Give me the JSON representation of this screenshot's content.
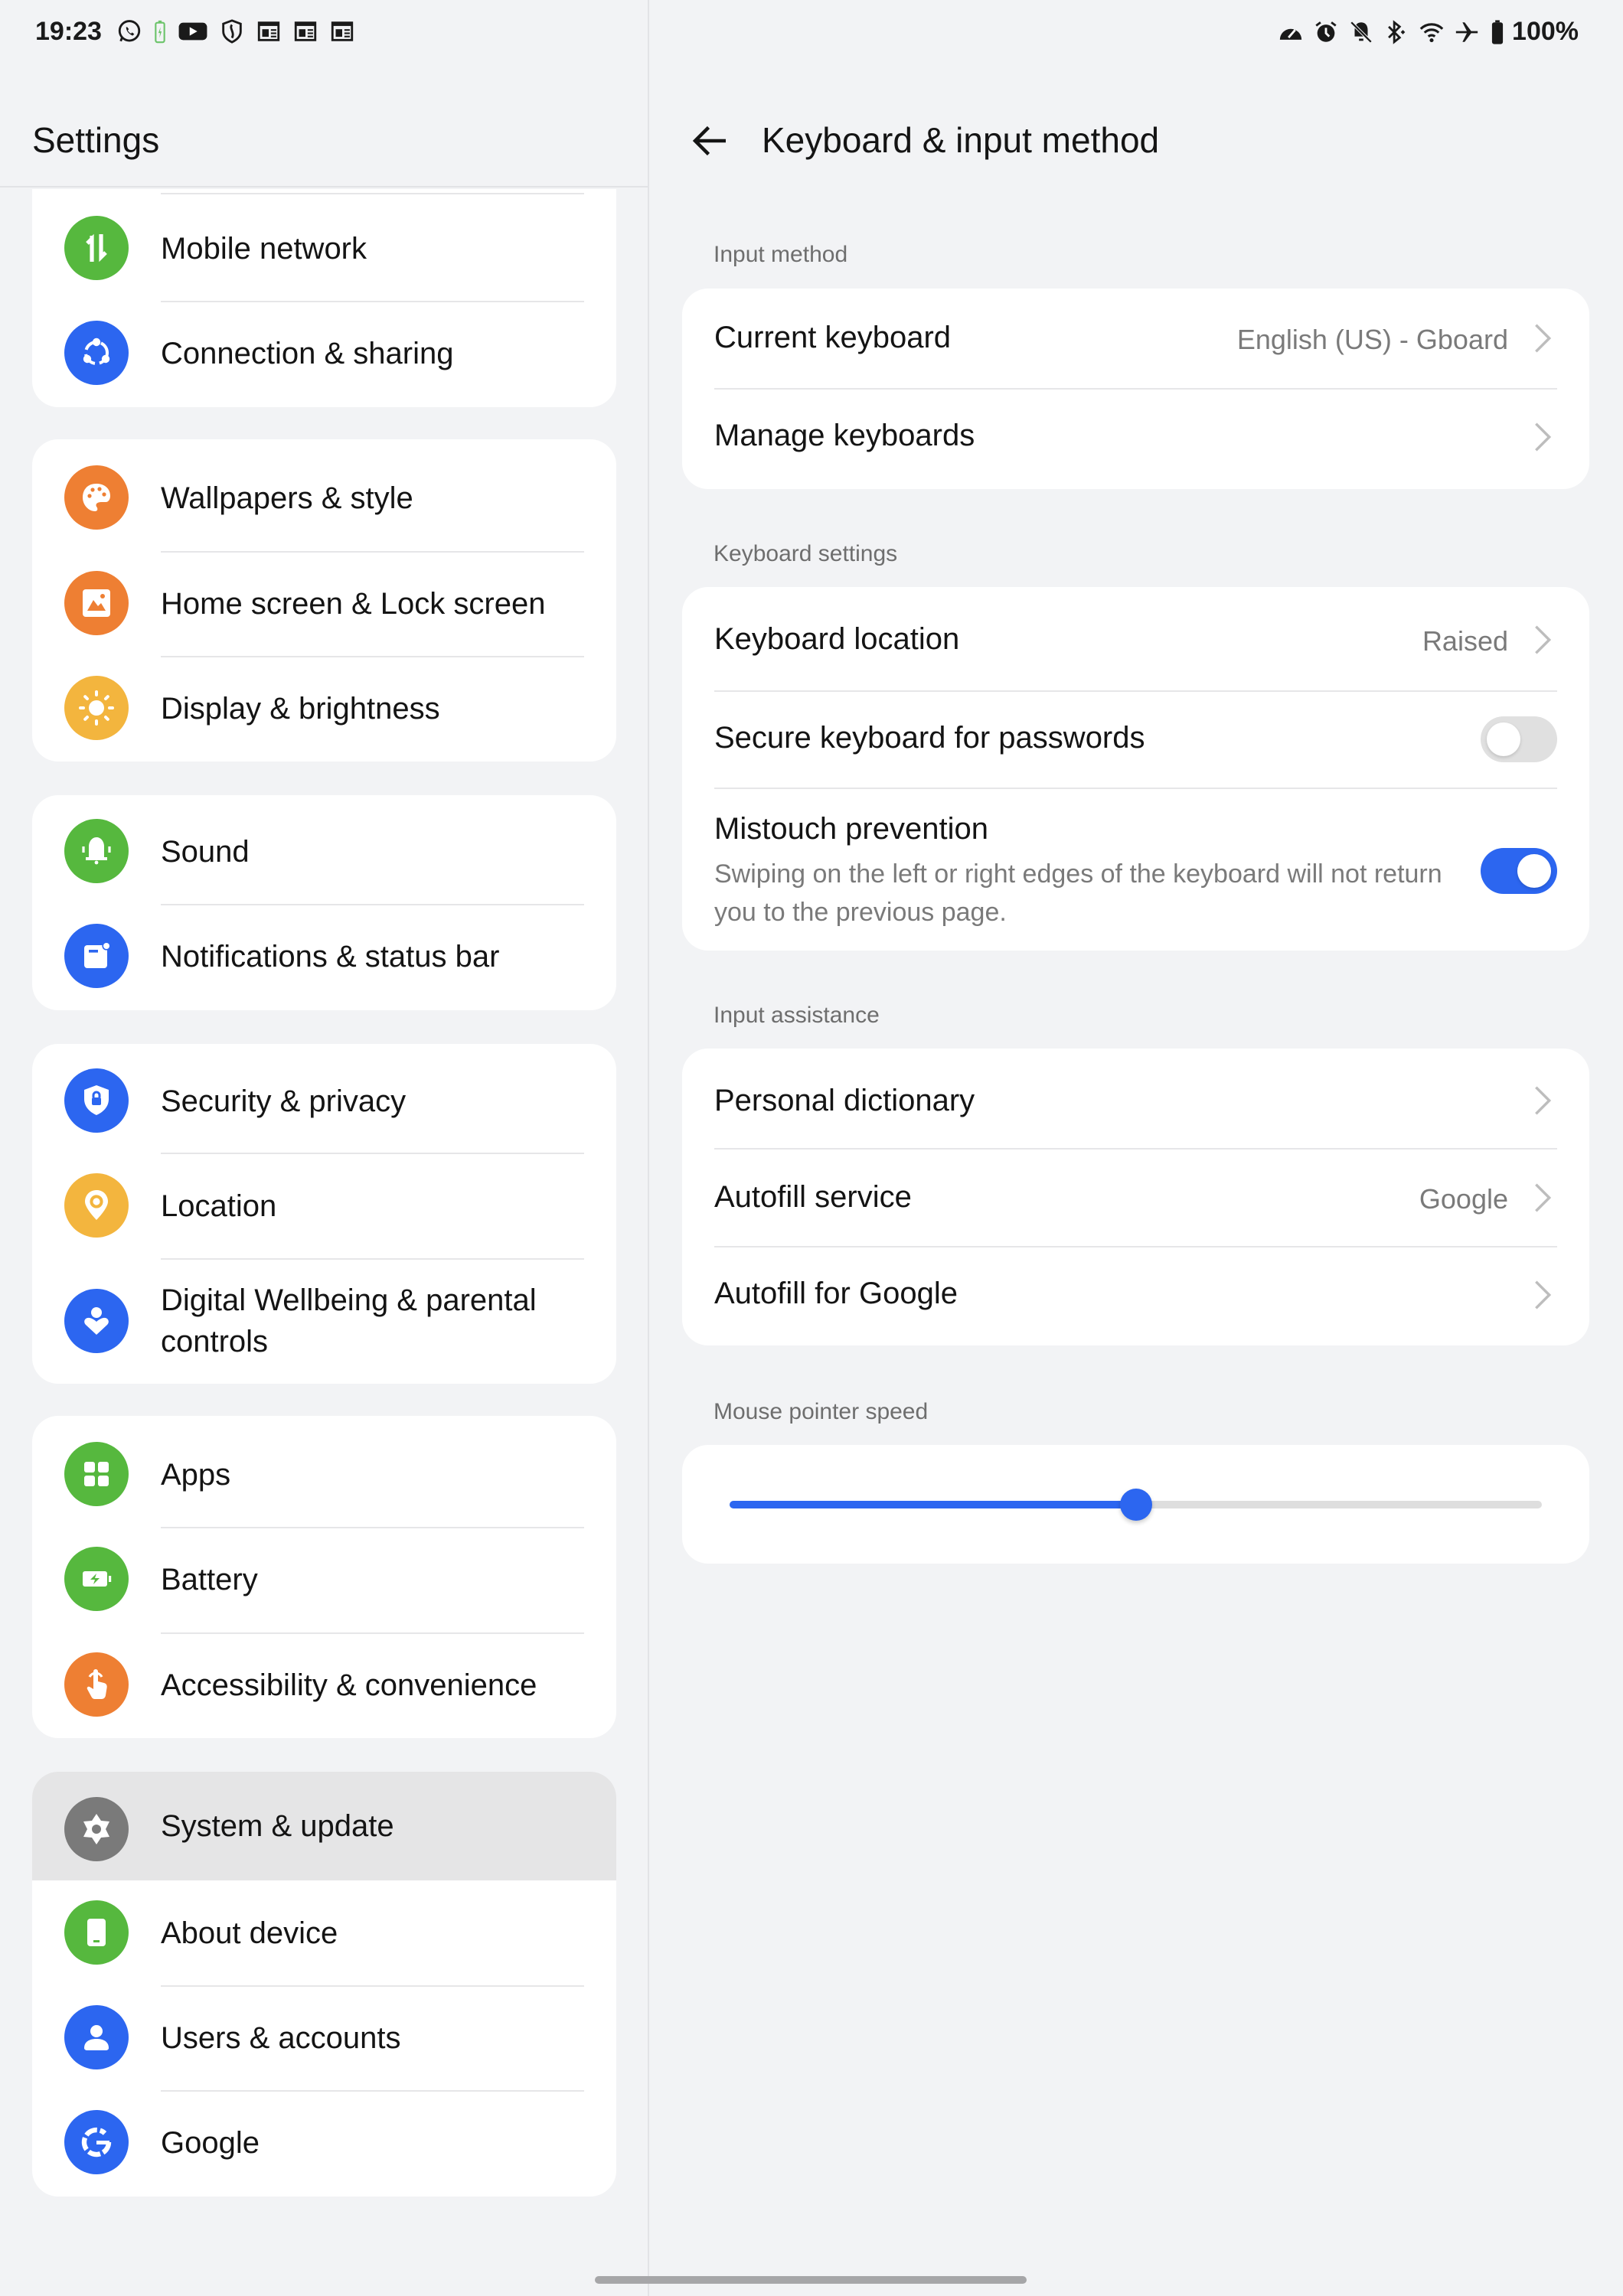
{
  "status_bar": {
    "time": "19:23",
    "left_icons": [
      "whatsapp-icon",
      "battery-saver-icon",
      "youtube-icon",
      "shield-icon",
      "news-icon",
      "news-icon",
      "news-icon"
    ],
    "right_icons": [
      "data-saver-icon",
      "alarm-icon",
      "bell-off-icon",
      "bluetooth-icon",
      "wifi-icon",
      "airplane-icon",
      "battery-icon"
    ],
    "battery_percent": "100%"
  },
  "left_pane": {
    "title": "Settings",
    "groups": [
      {
        "items": [
          {
            "label": "Mobile network",
            "icon": "mobile-data-icon",
            "color": "#56b83e"
          },
          {
            "label": "Connection & sharing",
            "icon": "share-icon",
            "color": "#2c66f0"
          }
        ]
      },
      {
        "items": [
          {
            "label": "Wallpapers & style",
            "icon": "palette-icon",
            "color": "#ee7f33"
          },
          {
            "label": "Home screen & Lock screen",
            "icon": "image-icon",
            "color": "#ee7f33"
          },
          {
            "label": "Display & brightness",
            "icon": "sun-icon",
            "color": "#f3b53e"
          }
        ]
      },
      {
        "items": [
          {
            "label": "Sound",
            "icon": "bell-icon",
            "color": "#56b83e"
          },
          {
            "label": "Notifications & status bar",
            "icon": "notification-icon",
            "color": "#2c66f0"
          }
        ]
      },
      {
        "items": [
          {
            "label": "Security & privacy",
            "icon": "shield-lock-icon",
            "color": "#2c66f0"
          },
          {
            "label": "Location",
            "icon": "location-pin-icon",
            "color": "#f3b53e"
          },
          {
            "label": "Digital Wellbeing & parental controls",
            "icon": "wellbeing-icon",
            "color": "#2c66f0"
          }
        ]
      },
      {
        "items": [
          {
            "label": "Apps",
            "icon": "apps-grid-icon",
            "color": "#56b83e"
          },
          {
            "label": "Battery",
            "icon": "battery-charging-icon",
            "color": "#56b83e"
          },
          {
            "label": "Accessibility & convenience",
            "icon": "touch-hand-icon",
            "color": "#ee7f33"
          }
        ]
      },
      {
        "items": [
          {
            "label": "System & update",
            "icon": "gear-icon",
            "color": "#7a7a7a",
            "selected": true
          },
          {
            "label": "About device",
            "icon": "phone-icon",
            "color": "#56b83e"
          },
          {
            "label": "Users & accounts",
            "icon": "user-icon",
            "color": "#2c66f0"
          },
          {
            "label": "Google",
            "icon": "google-icon",
            "color": "#2c66f0"
          }
        ]
      }
    ]
  },
  "right_pane": {
    "title": "Keyboard & input method",
    "back_icon": "back-arrow-icon",
    "sections": {
      "input_method": {
        "label": "Input method",
        "current_keyboard": {
          "label": "Current keyboard",
          "value": "English (US) - Gboard"
        },
        "manage_keyboards": {
          "label": "Manage keyboards"
        }
      },
      "keyboard_settings": {
        "label": "Keyboard settings",
        "keyboard_location": {
          "label": "Keyboard location",
          "value": "Raised"
        },
        "secure_keyboard": {
          "label": "Secure keyboard for passwords",
          "enabled": false
        },
        "mistouch": {
          "label": "Mistouch prevention",
          "description": "Swiping on the left or right edges of the keyboard will not return you to the previous page.",
          "enabled": true
        }
      },
      "input_assistance": {
        "label": "Input assistance",
        "personal_dictionary": {
          "label": "Personal dictionary"
        },
        "autofill_service": {
          "label": "Autofill service",
          "value": "Google"
        },
        "autofill_google": {
          "label": "Autofill for Google"
        }
      },
      "mouse_pointer_speed": {
        "label": "Mouse pointer speed",
        "value_fraction": 0.5
      }
    }
  },
  "colors": {
    "accent": "#2c66f0",
    "background": "#f2f3f5",
    "card": "#ffffff",
    "secondary_text": "#7a7a7a"
  }
}
